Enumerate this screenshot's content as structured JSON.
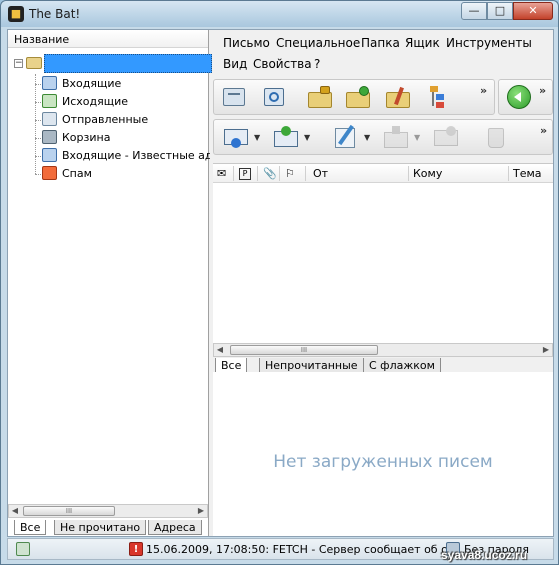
{
  "window": {
    "title": "The Bat!",
    "controls": [
      "minimize",
      "maximize",
      "close"
    ]
  },
  "folder_pane": {
    "column_header": "Название",
    "root_account": "",
    "folders": [
      {
        "label": "Входящие",
        "icon": "inbox-folder-icon"
      },
      {
        "label": "Исходящие",
        "icon": "outbox-folder-icon"
      },
      {
        "label": "Отправленные",
        "icon": "sent-folder-icon"
      },
      {
        "label": "Корзина",
        "icon": "trash-folder-icon"
      },
      {
        "label": "Входящие - Известные ад...",
        "icon": "inbox-folder-icon"
      },
      {
        "label": "Спам",
        "icon": "spam-folder-icon"
      }
    ],
    "tabs": [
      "Все",
      "Не прочитано",
      "Адреса"
    ],
    "active_tab": "Все"
  },
  "menu": {
    "items": [
      "Письмо",
      "Специальное",
      "Папка",
      "Ящик",
      "Инструменты",
      "Вид",
      "Свойства",
      "?"
    ]
  },
  "toolbar_top": {
    "buttons": [
      "get-mail-icon",
      "send-queued-icon",
      "folder-lock-icon",
      "new-folder-icon",
      "folder-tools-icon",
      "address-tree-icon"
    ],
    "more": "»",
    "extra_button": "green-back-icon"
  },
  "toolbar_bottom": {
    "buttons": [
      "mail-envelope-icon",
      "send-mail-icon",
      "compose-pen-icon",
      "reply-icon",
      "forward-icon",
      "delete-trash-icon"
    ],
    "more": "»"
  },
  "message_list": {
    "columns": [
      "От",
      "Кому",
      "Тема"
    ],
    "icon_columns": [
      "envelope-col-icon",
      "priority-col-icon",
      "attachment-col-icon",
      "flag-col-icon"
    ],
    "priority_glyph": "P",
    "tabs": [
      "Все",
      "Непрочитанные",
      "С флажком"
    ],
    "active_tab": "Все",
    "scroll_grip": "III"
  },
  "viewer": {
    "empty_text": "Нет загруженных писем"
  },
  "statusbar": {
    "message": "15.06.2009, 17:08:50: FETCH - Сервер сообщает об ош...",
    "password": "Без пароля"
  },
  "watermark": "syava8.ucoz.ru"
}
